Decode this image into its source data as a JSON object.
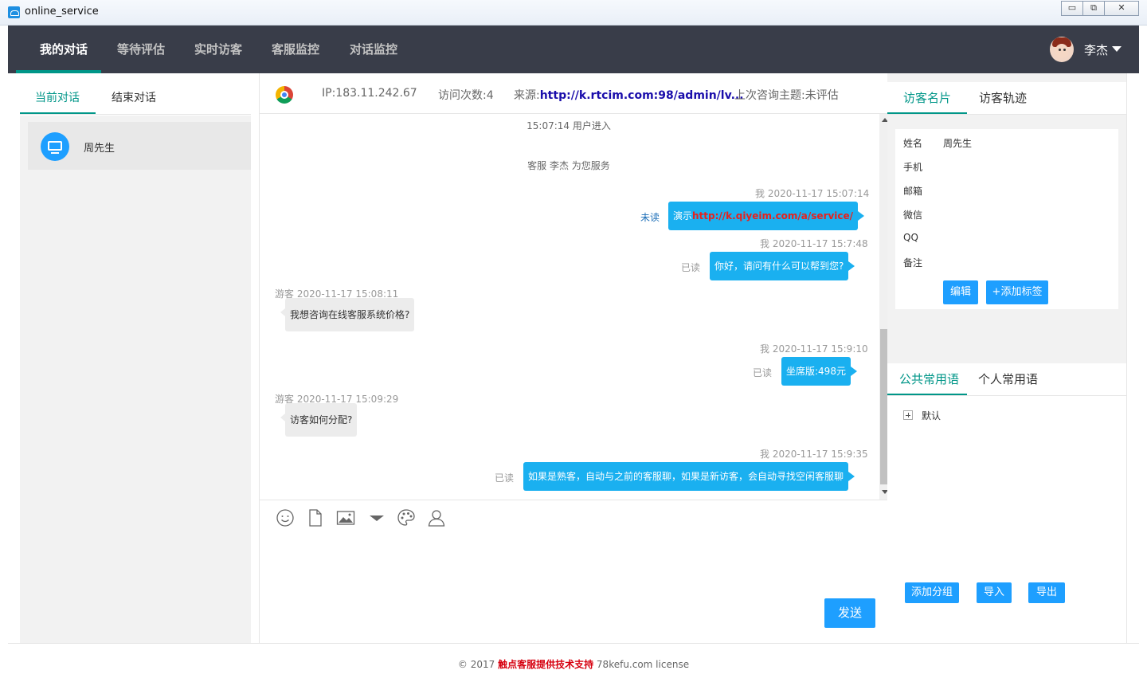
{
  "window": {
    "title": "online_service",
    "minimize_glyph": "▭",
    "maximize_glyph": "⧉",
    "close_glyph": "✕"
  },
  "nav": {
    "items": [
      "我的对话",
      "等待评估",
      "实时访客",
      "客服监控",
      "对话监控"
    ],
    "active_index": 0,
    "user_name": "李杰"
  },
  "left": {
    "tabs": [
      "当前对话",
      "结束对话"
    ],
    "conversations": [
      {
        "name": "周先生",
        "icon": "monitor-icon"
      }
    ]
  },
  "visitor_bar": {
    "browser_icon": "chrome-icon",
    "ip": "IP:183.11.242.67",
    "visits": "访问次数:4",
    "source_label": "来源:",
    "source_url": "http://k.rtcim.com:98/admin/lv...",
    "last_topic": "上次咨询主题:未评估"
  },
  "chat": {
    "system_enter": "15:07:14 用户进入",
    "system_service": "客服 李杰 为您服务",
    "messages": [
      {
        "from": "me",
        "meta": "我 2020-11-17 15:07:14",
        "prefix": "演示",
        "link": "http://k.qiyeim.com/a/service/",
        "status": "未读"
      },
      {
        "from": "me",
        "meta": "我 2020-11-17 15:7:48",
        "text": "你好，请问有什么可以帮到您?",
        "status": "已读"
      },
      {
        "from": "guest",
        "meta": "游客 2020-11-17 15:08:11",
        "text": "我想咨询在线客服系统价格?"
      },
      {
        "from": "me",
        "meta": "我 2020-11-17 15:9:10",
        "text": "坐席版:498元",
        "status": "已读"
      },
      {
        "from": "guest",
        "meta": "游客 2020-11-17 15:09:29",
        "text": "访客如何分配?"
      },
      {
        "from": "me",
        "meta": "我 2020-11-17 15:9:35",
        "text": "如果是熟客，自动与之前的客服聊，如果是新访客，会自动寻找空闲客服聊",
        "status": "已读"
      }
    ]
  },
  "toolbar": {
    "icons": [
      "emoji-icon",
      "file-icon",
      "image-icon",
      "dropdown-icon",
      "palette-icon",
      "transfer-user-icon"
    ]
  },
  "send_label": "发送",
  "right": {
    "tabs": [
      "访客名片",
      "访客轨迹"
    ],
    "fields": [
      {
        "label": "姓名",
        "value": "周先生"
      },
      {
        "label": "手机",
        "value": ""
      },
      {
        "label": "邮箱",
        "value": ""
      },
      {
        "label": "微信",
        "value": ""
      },
      {
        "label": "QQ",
        "value": ""
      },
      {
        "label": "备注",
        "value": ""
      }
    ],
    "edit_label": "编辑",
    "add_tag_label": "+添加标签",
    "quick_tabs": [
      "公共常用语",
      "个人常用语"
    ],
    "tree_root": "默认",
    "add_group_label": "添加分组",
    "import_label": "导入",
    "export_label": "导出"
  },
  "footer": {
    "prefix": "© 2017 ",
    "brand": "触点客服提供技术支持",
    "suffix": " 78kefu.com license"
  }
}
